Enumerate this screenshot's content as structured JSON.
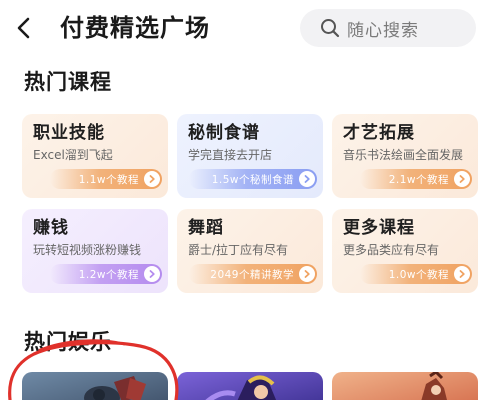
{
  "header": {
    "title": "付费精选广场",
    "search_placeholder": "随心搜索"
  },
  "sections": {
    "hot_courses": "热门课程",
    "hot_entertainment": "热门娱乐"
  },
  "cards": [
    {
      "title": "职业技能",
      "subtitle": "Excel溜到飞起",
      "badge": "1.1w个教程",
      "accent": "#f2a766"
    },
    {
      "title": "秘制食谱",
      "subtitle": "学完直接去开店",
      "badge": "1.5w个秘制食谱",
      "accent": "#8fa3f5"
    },
    {
      "title": "才艺拓展",
      "subtitle": "音乐书法绘画全面发展",
      "badge": "2.1w个教程",
      "accent": "#f2a766"
    },
    {
      "title": "赚钱",
      "subtitle": "玩转短视频涨粉赚钱",
      "badge": "1.2w个教程",
      "accent": "#b98cf0"
    },
    {
      "title": "舞蹈",
      "subtitle": "爵士/拉丁应有尽有",
      "badge": "2049个精讲教学",
      "accent": "#f2a766"
    },
    {
      "title": "更多课程",
      "subtitle": "更多品类应有尽有",
      "badge": "1.0w个教程",
      "accent": "#f2a766"
    }
  ],
  "colors": {
    "annotation_circle": "#e0312b",
    "card_bg_orange": "#fdf0e4",
    "card_bg_blue": "#ecf0fd",
    "card_bg_purple": "#f3ecfd"
  }
}
